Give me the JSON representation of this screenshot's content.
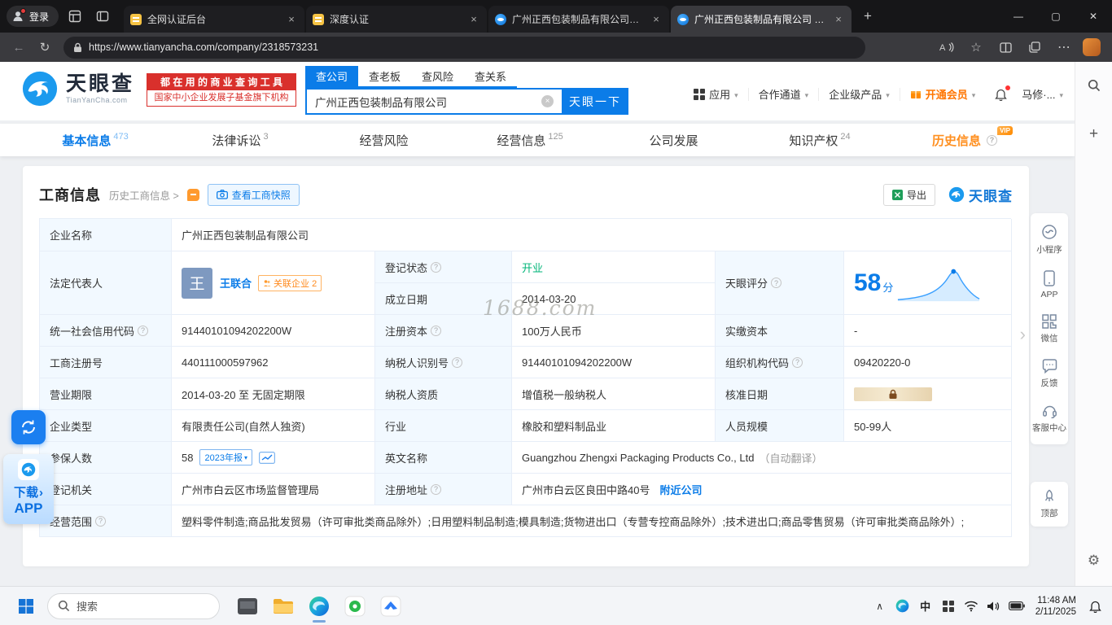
{
  "browser": {
    "login": "登录",
    "tabs": [
      {
        "title": "全网认证后台"
      },
      {
        "title": "深度认证"
      },
      {
        "title": "广州正西包装制品有限公司_相关"
      },
      {
        "title": "广州正西包装制品有限公司 - 天"
      }
    ],
    "url": "https://www.tianyancha.com/company/2318573231"
  },
  "header": {
    "logo_text": "天眼查",
    "logo_domain": "TianYanCha.com",
    "promo_top": "都 在 用 的 商 业 查 询 工 具",
    "promo_bottom": "国家中小企业发展子基金旗下机构",
    "search_tabs": [
      "查公司",
      "查老板",
      "查风险",
      "查关系"
    ],
    "search_value": "广州正西包装制品有限公司",
    "search_button": "天眼一下",
    "nav_app": "应用",
    "nav_channel": "合作通道",
    "nav_product": "企业级产品",
    "nav_vip": "开通会员",
    "user_name": "马修·..."
  },
  "page_tabs": [
    {
      "label": "基本信息",
      "count": "473"
    },
    {
      "label": "法律诉讼",
      "count": "3"
    },
    {
      "label": "经营风险",
      "count": ""
    },
    {
      "label": "经营信息",
      "count": "125"
    },
    {
      "label": "公司发展",
      "count": ""
    },
    {
      "label": "知识产权",
      "count": "24"
    },
    {
      "label": "历史信息",
      "count": "",
      "vip": "VIP"
    }
  ],
  "section": {
    "title": "工商信息",
    "history_link": "历史工商信息 >",
    "snapshot_btn": "查看工商快照",
    "export_btn": "导出",
    "brand_logo": "天眼查",
    "watermark": "1688.com"
  },
  "info": {
    "company_name_label": "企业名称",
    "company_name": "广州正西包装制品有限公司",
    "legal_rep_label": "法定代表人",
    "legal_rep_avatar": "王",
    "legal_rep_name": "王联合",
    "related_badge": "关联企业 2",
    "status_label": "登记状态",
    "status_value": "开业",
    "established_label": "成立日期",
    "established_value": "2014-03-20",
    "score_label": "天眼评分",
    "score_value": "58",
    "score_unit": "分",
    "credit_code_label": "统一社会信用代码",
    "credit_code": "91440101094202200W",
    "reg_capital_label": "注册资本",
    "reg_capital": "100万人民币",
    "paid_capital_label": "实缴资本",
    "paid_capital": "-",
    "reg_no_label": "工商注册号",
    "reg_no": "440111000597962",
    "tax_id_label": "纳税人识别号",
    "tax_id": "91440101094202200W",
    "org_code_label": "组织机构代码",
    "org_code": "09420220-0",
    "term_label": "营业期限",
    "term_value": "2014-03-20 至 无固定期限",
    "tax_quality_label": "纳税人资质",
    "tax_quality": "增值税一般纳税人",
    "approve_date_label": "核准日期",
    "type_label": "企业类型",
    "type_value": "有限责任公司(自然人独资)",
    "industry_label": "行业",
    "industry_value": "橡胶和塑料制品业",
    "staff_label": "人员规模",
    "staff_value": "50-99人",
    "insured_label": "参保人数",
    "insured_value": "58",
    "insured_badge": "2023年报",
    "en_name_label": "英文名称",
    "en_name": "Guangzhou Zhengxi Packaging Products Co., Ltd",
    "en_name_note": "（自动翻译）",
    "authority_label": "登记机关",
    "authority_value": "广州市白云区市场监督管理局",
    "address_label": "注册地址",
    "address_value": "广州市白云区良田中路40号",
    "address_link": "附近公司",
    "scope_label": "经营范围",
    "scope_value": "塑料零件制造;商品批发贸易（许可审批类商品除外）;日用塑料制品制造;模具制造;货物进出口（专营专控商品除外）;技术进出口;商品零售贸易（许可审批类商品除外）;"
  },
  "float_rail": {
    "mini_program": "小程序",
    "app": "APP",
    "wechat": "微信",
    "feedback": "反馈",
    "service": "客服中心",
    "top": "顶部"
  },
  "download": {
    "line1": "下载",
    "line2": "APP"
  },
  "taskbar": {
    "search": "搜索",
    "ime": "中",
    "time": "11:48 AM",
    "date": "2/11/2025"
  }
}
